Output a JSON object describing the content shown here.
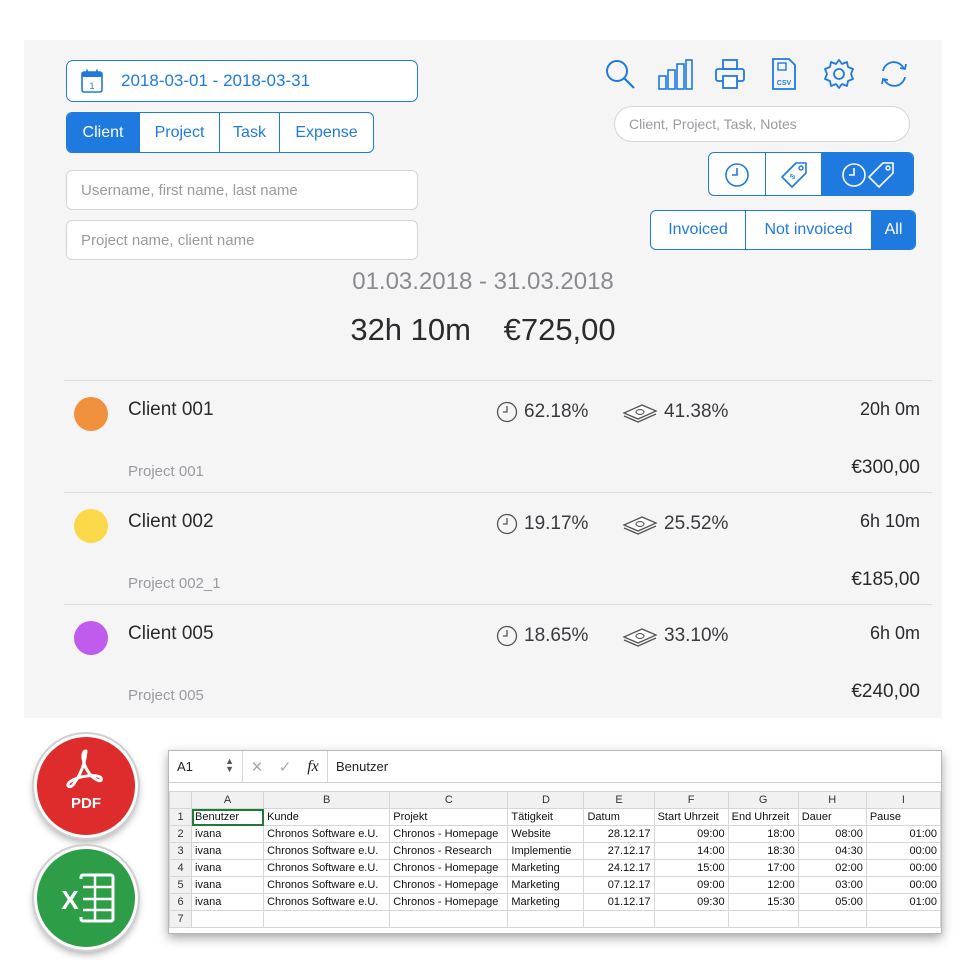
{
  "date_range": "2018-03-01 - 2018-03-31",
  "tabs": [
    "Client",
    "Project",
    "Task",
    "Expense"
  ],
  "active_tab": "Client",
  "filters": {
    "user_placeholder": "Username, first name, last name",
    "project_placeholder": "Project name, client name",
    "search_placeholder": "Client, Project, Task, Notes"
  },
  "toolbar_icons": [
    "search-icon",
    "bar-chart-icon",
    "print-icon",
    "csv-icon",
    "settings-icon",
    "refresh-icon"
  ],
  "invoice_filter": [
    "Invoiced",
    "Not invoiced",
    "All"
  ],
  "active_invoice_filter": "All",
  "summary": {
    "period": "01.03.2018 - 31.03.2018",
    "total_time": "32h 10m",
    "total_amount": "€725,00"
  },
  "rows": [
    {
      "client": "Client 001",
      "color": "#f0913e",
      "time_pct": "62.18%",
      "money_pct": "41.38%",
      "duration": "20h 0m",
      "project": "Project 001",
      "amount": "€300,00"
    },
    {
      "client": "Client 002",
      "color": "#fbd84a",
      "time_pct": "19.17%",
      "money_pct": "25.52%",
      "duration": "6h 10m",
      "project": "Project 002_1",
      "amount": "€185,00"
    },
    {
      "client": "Client 005",
      "color": "#c05ced",
      "time_pct": "18.65%",
      "money_pct": "33.10%",
      "duration": "6h 0m",
      "project": "Project 005",
      "amount": "€240,00"
    }
  ],
  "export_badges": {
    "pdf_label": "PDF",
    "excel_label": "X"
  },
  "spreadsheet": {
    "cell_ref": "A1",
    "formula_value": "Benutzer",
    "columns": [
      "A",
      "B",
      "C",
      "D",
      "E",
      "F",
      "G",
      "H",
      "I"
    ],
    "rows": [
      [
        "Benutzer",
        "Kunde",
        "Projekt",
        "Tätigkeit",
        "Datum",
        "Start Uhrzeit",
        "End Uhrzeit",
        "Dauer",
        "Pause"
      ],
      [
        "ivana",
        "Chronos Software e.U.",
        "Chronos - Homepage",
        "Website",
        "28.12.17",
        "09:00",
        "18:00",
        "08:00",
        "01:00"
      ],
      [
        "ivana",
        "Chronos Software e.U.",
        "Chronos - Research",
        "Implementie",
        "27.12.17",
        "14:00",
        "18:30",
        "04:30",
        "00:00"
      ],
      [
        "ivana",
        "Chronos Software e.U.",
        "Chronos - Homepage",
        "Marketing",
        "24.12.17",
        "15:00",
        "17:00",
        "02:00",
        "00:00"
      ],
      [
        "ivana",
        "Chronos Software e.U.",
        "Chronos - Homepage",
        "Marketing",
        "07.12.17",
        "09:00",
        "12:00",
        "03:00",
        "00:00"
      ],
      [
        "ivana",
        "Chronos Software e.U.",
        "Chronos - Homepage",
        "Marketing",
        "01.12.17",
        "09:30",
        "15:30",
        "05:00",
        "01:00"
      ],
      [
        "",
        "",
        "",
        "",
        "",
        "",
        "",
        "",
        ""
      ]
    ]
  },
  "colors": {
    "accent": "#1f7ae0",
    "pdf_red": "#de2b2b",
    "excel_green": "#2e9d48"
  }
}
